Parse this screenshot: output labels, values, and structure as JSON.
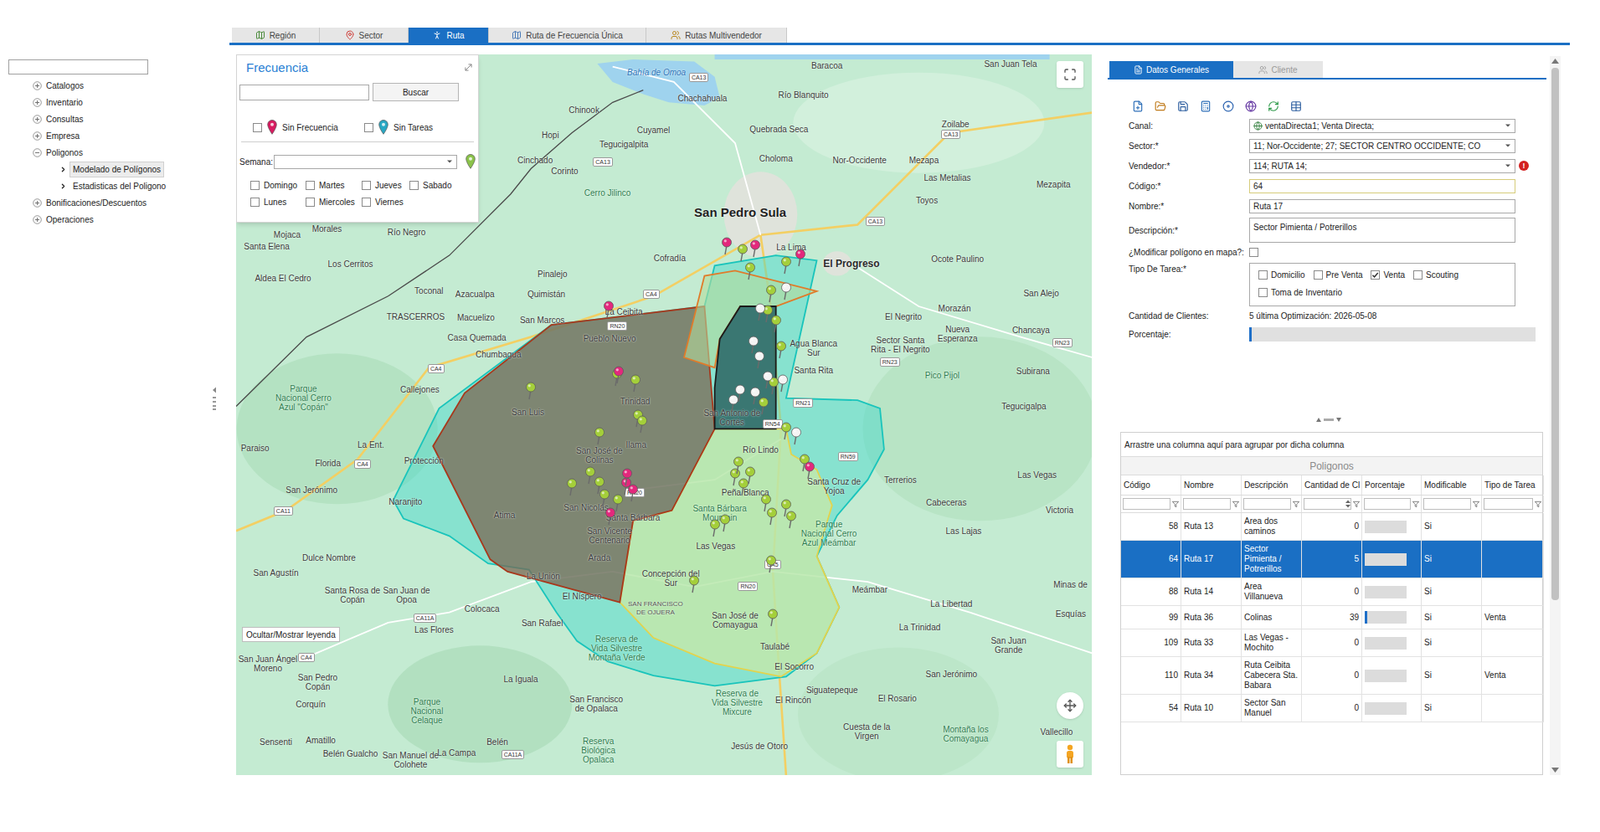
{
  "sidebar": {
    "search": {
      "value": ""
    },
    "tree": [
      {
        "label": "Catalogos",
        "expanded": false,
        "children": []
      },
      {
        "label": "Inventario",
        "expanded": false,
        "children": []
      },
      {
        "label": "Consultas",
        "expanded": false,
        "children": []
      },
      {
        "label": "Empresa",
        "expanded": false,
        "children": []
      },
      {
        "label": "Poligonos",
        "expanded": true,
        "children": [
          {
            "label": "Modelado de Polígonos",
            "selected": true
          },
          {
            "label": "Estadisticas del Poligono",
            "selected": false
          }
        ]
      },
      {
        "label": "Bonificaciones/Descuentos",
        "expanded": false,
        "children": []
      },
      {
        "label": "Operaciones",
        "expanded": false,
        "children": []
      }
    ]
  },
  "tabs": [
    {
      "label": "Región",
      "selected": false
    },
    {
      "label": "Sector",
      "selected": false
    },
    {
      "label": "Ruta",
      "selected": true
    },
    {
      "label": "Ruta de Frecuencia Única",
      "selected": false
    },
    {
      "label": "Rutas Multivendedor",
      "selected": false
    }
  ],
  "frequency_panel": {
    "title": "Frecuencia",
    "search": {
      "value": ""
    },
    "search_button": "Buscar",
    "legend": [
      {
        "label": "Sin Frecuencia",
        "checked": false,
        "color": "#d81b60"
      },
      {
        "label": "Sin Tareas",
        "checked": false,
        "color": "#29a8c4"
      }
    ],
    "week": {
      "label": "Semana:",
      "value": ""
    },
    "days": [
      {
        "label": "Domingo",
        "checked": false
      },
      {
        "label": "Martes",
        "checked": false
      },
      {
        "label": "Jueves",
        "checked": false
      },
      {
        "label": "Sabado",
        "checked": false
      },
      {
        "label": "Lunes",
        "checked": false
      },
      {
        "label": "Miercoles",
        "checked": false
      },
      {
        "label": "Viernes",
        "checked": false
      }
    ]
  },
  "map": {
    "legend_button": "Ocultar/Mostrar leyenda",
    "polygons": [
      {
        "color": "#3ed6cc"
      },
      {
        "color": "#cfe9a4"
      },
      {
        "color": "#7b6753"
      },
      {
        "color": "#b5dc9c"
      },
      {
        "color": "#2d6462"
      }
    ],
    "labels": [
      {
        "text": "Bahía de Omoa",
        "kind": "water"
      },
      {
        "text": "Chachahuala",
        "kind": "place"
      },
      {
        "text": "Río Blanquito",
        "kind": "place"
      },
      {
        "text": "Baracoa",
        "kind": "place"
      },
      {
        "text": "San Juan Tela",
        "kind": "place"
      },
      {
        "text": "Chinook",
        "kind": "place"
      },
      {
        "text": "Hopi",
        "kind": "place"
      },
      {
        "text": "Cuyamel",
        "kind": "place"
      },
      {
        "text": "Tegucigalpita",
        "kind": "place"
      },
      {
        "text": "Quebrada Seca",
        "kind": "place"
      },
      {
        "text": "Zoilabe",
        "kind": "place"
      },
      {
        "text": "Choloma",
        "kind": "place"
      },
      {
        "text": "Nor-Occidente",
        "kind": "place"
      },
      {
        "text": "Mezapa",
        "kind": "place"
      },
      {
        "text": "Cinchado",
        "kind": "place"
      },
      {
        "text": "Corinto",
        "kind": "place"
      },
      {
        "text": "Las Metalias",
        "kind": "place"
      },
      {
        "text": "Mezapita",
        "kind": "place"
      },
      {
        "text": "Cerro Jilinco",
        "kind": "park"
      },
      {
        "text": "Toyos",
        "kind": "place"
      },
      {
        "text": "San Pedro Sula",
        "kind": "city"
      },
      {
        "text": "Mojaca",
        "kind": "place"
      },
      {
        "text": "Morales",
        "kind": "place"
      },
      {
        "text": "Río Negro",
        "kind": "place"
      },
      {
        "text": "Santa Elena",
        "kind": "place"
      },
      {
        "text": "Cofradía",
        "kind": "place"
      },
      {
        "text": "La Lima",
        "kind": "place"
      },
      {
        "text": "El Progreso",
        "kind": "town"
      },
      {
        "text": "Ocote Paulino",
        "kind": "place"
      },
      {
        "text": "Los Cerritos",
        "kind": "place"
      },
      {
        "text": "Aldea El Cedro",
        "kind": "place"
      },
      {
        "text": "Pinalejo",
        "kind": "place"
      },
      {
        "text": "Toconal",
        "kind": "place"
      },
      {
        "text": "Azacualpa",
        "kind": "place"
      },
      {
        "text": "Quimistán",
        "kind": "place"
      },
      {
        "text": "San Alejo",
        "kind": "place"
      },
      {
        "text": "Morazán",
        "kind": "place"
      },
      {
        "text": "El Negrito",
        "kind": "place"
      },
      {
        "text": "TRASCERROS",
        "kind": "place"
      },
      {
        "text": "Macuelizo",
        "kind": "place"
      },
      {
        "text": "San Marcos",
        "kind": "place"
      },
      {
        "text": "La Ceibita",
        "kind": "place"
      },
      {
        "text": "Pueblo Nuevo",
        "kind": "place"
      },
      {
        "text": "Casa Quemada",
        "kind": "place"
      },
      {
        "text": "Chumbagua",
        "kind": "place"
      },
      {
        "text": "Nueva Esperanza",
        "kind": "place"
      },
      {
        "text": "Chancaya",
        "kind": "place"
      },
      {
        "text": "Agua Blanca Sur",
        "kind": "place"
      },
      {
        "text": "Santa Rita",
        "kind": "place"
      },
      {
        "text": "Sector Santa Rita - El Negrito",
        "kind": "place"
      },
      {
        "text": "Pico Pijol",
        "kind": "park"
      },
      {
        "text": "Subirana",
        "kind": "place"
      },
      {
        "text": "Callejones",
        "kind": "place"
      },
      {
        "text": "Parque Nacional Cerro Azul \"Copán\"",
        "kind": "park"
      },
      {
        "text": "San Luis",
        "kind": "place"
      },
      {
        "text": "Trinidad",
        "kind": "place"
      },
      {
        "text": "San Antonio de Cortés",
        "kind": "place"
      },
      {
        "text": "Tegucigalpa",
        "kind": "place"
      },
      {
        "text": "Ilama",
        "kind": "place"
      },
      {
        "text": "La Ent.",
        "kind": "place"
      },
      {
        "text": "Paraiso",
        "kind": "place"
      },
      {
        "text": "San José de Colinas",
        "kind": "place"
      },
      {
        "text": "Río Lindo",
        "kind": "place"
      },
      {
        "text": "Florida",
        "kind": "place"
      },
      {
        "text": "Protección",
        "kind": "place"
      },
      {
        "text": "Terrerios",
        "kind": "place"
      },
      {
        "text": "Las Vegas",
        "kind": "place"
      },
      {
        "text": "San Jerónimo",
        "kind": "place"
      },
      {
        "text": "Peña Blanca",
        "kind": "place"
      },
      {
        "text": "Santa Cruz de Yojoa",
        "kind": "place"
      },
      {
        "text": "Naranjito",
        "kind": "place"
      },
      {
        "text": "Cabeceras",
        "kind": "place"
      },
      {
        "text": "Victoria",
        "kind": "place"
      },
      {
        "text": "San Nicolás",
        "kind": "place"
      },
      {
        "text": "Atima",
        "kind": "place"
      },
      {
        "text": "Santa Bárbara",
        "kind": "place"
      },
      {
        "text": "Santa Bárbara Mountain",
        "kind": "park"
      },
      {
        "text": "San Vicente Centenario",
        "kind": "place"
      },
      {
        "text": "Las Vegas",
        "kind": "place"
      },
      {
        "text": "Parque Nacional Cerro Azul Meámbar",
        "kind": "park"
      },
      {
        "text": "Las Lajas",
        "kind": "place"
      },
      {
        "text": "Dulce Nombre",
        "kind": "place"
      },
      {
        "text": "Arada",
        "kind": "place"
      },
      {
        "text": "San Agustín",
        "kind": "place"
      },
      {
        "text": "La Unión",
        "kind": "place"
      },
      {
        "text": "Concepción del Sur",
        "kind": "place"
      },
      {
        "text": "Meámbar",
        "kind": "place"
      },
      {
        "text": "Minas de",
        "kind": "place"
      },
      {
        "text": "Santa Rosa de Copán",
        "kind": "place"
      },
      {
        "text": "San Juan de Opoa",
        "kind": "place"
      },
      {
        "text": "El Níspero",
        "kind": "place"
      },
      {
        "text": "Colocaca",
        "kind": "place"
      },
      {
        "text": "SAN FRANCISCO DE OJUERA",
        "kind": "area"
      },
      {
        "text": "La Libertad",
        "kind": "place"
      },
      {
        "text": "Esquías",
        "kind": "place"
      },
      {
        "text": "San Rafael",
        "kind": "place"
      },
      {
        "text": "San José de Comayagua",
        "kind": "place"
      },
      {
        "text": "La Trinidad",
        "kind": "place"
      },
      {
        "text": "Las Flores",
        "kind": "place"
      },
      {
        "text": "Reserva de Vida Silvestre Montaña Verde",
        "kind": "park"
      },
      {
        "text": "Taulabé",
        "kind": "place"
      },
      {
        "text": "San Juan Grande",
        "kind": "place"
      },
      {
        "text": "El Socorro",
        "kind": "place"
      },
      {
        "text": "La Iguala",
        "kind": "place"
      },
      {
        "text": "San Jerónimo",
        "kind": "place"
      },
      {
        "text": "San Juan Ángel Moreno",
        "kind": "place"
      },
      {
        "text": "San Pedro Copán",
        "kind": "place"
      },
      {
        "text": "Siguatepeque",
        "kind": "place"
      },
      {
        "text": "Corquín",
        "kind": "place"
      },
      {
        "text": "Parque Nacional Celaque",
        "kind": "park"
      },
      {
        "text": "San Francisco de Opalaca",
        "kind": "place"
      },
      {
        "text": "Reserva de Vida Silvestre Mixcure",
        "kind": "park"
      },
      {
        "text": "El Rincón",
        "kind": "place"
      },
      {
        "text": "El Rosario",
        "kind": "place"
      },
      {
        "text": "Sensenti",
        "kind": "place"
      },
      {
        "text": "Amatillo",
        "kind": "place"
      },
      {
        "text": "Belén",
        "kind": "place"
      },
      {
        "text": "Reserva Biológica Opalaca",
        "kind": "park"
      },
      {
        "text": "Belén Gualcho",
        "kind": "place"
      },
      {
        "text": "La Campa",
        "kind": "place"
      },
      {
        "text": "Jesús de Otoro",
        "kind": "place"
      },
      {
        "text": "Cuesta de la Virgen",
        "kind": "place"
      },
      {
        "text": "Montaña los Comayagua",
        "kind": "park"
      },
      {
        "text": "Vallecillo",
        "kind": "place"
      },
      {
        "text": "San Manuel de Colohete",
        "kind": "place"
      }
    ],
    "road_shields": [
      "CA13",
      "CA13",
      "CA13",
      "CA13",
      "CA4",
      "CA4",
      "CA4",
      "CA11",
      "RN20",
      "RN20",
      "RN54",
      "RN21",
      "RN59",
      "CA5",
      "RN20",
      "RN23",
      "RN23",
      "CA11A",
      "CA4",
      "CA11A"
    ],
    "pins": [
      {
        "color": "#a4cf3a"
      },
      {
        "color": "#a4cf3a"
      },
      {
        "color": "#a4cf3a"
      },
      {
        "color": "#a4cf3a"
      },
      {
        "color": "#a4cf3a"
      },
      {
        "color": "#a4cf3a"
      },
      {
        "color": "#a4cf3a"
      },
      {
        "color": "#a4cf3a"
      },
      {
        "color": "#a4cf3a"
      },
      {
        "color": "#a4cf3a"
      },
      {
        "color": "#a4cf3a"
      },
      {
        "color": "#a4cf3a"
      },
      {
        "color": "#a4cf3a"
      },
      {
        "color": "#a4cf3a"
      },
      {
        "color": "#a4cf3a"
      },
      {
        "color": "#a4cf3a"
      },
      {
        "color": "#a4cf3a"
      },
      {
        "color": "#a4cf3a"
      },
      {
        "color": "#a4cf3a"
      },
      {
        "color": "#a4cf3a"
      },
      {
        "color": "#a4cf3a"
      },
      {
        "color": "#a4cf3a"
      },
      {
        "color": "#a4cf3a"
      },
      {
        "color": "#a4cf3a"
      },
      {
        "color": "#a4cf3a"
      },
      {
        "color": "#a4cf3a"
      },
      {
        "color": "#a4cf3a"
      },
      {
        "color": "#a4cf3a"
      },
      {
        "color": "#a4cf3a"
      },
      {
        "color": "#a4cf3a"
      },
      {
        "color": "#a4cf3a"
      },
      {
        "color": "#a4cf3a"
      },
      {
        "color": "#a4cf3a"
      },
      {
        "color": "#a4cf3a"
      },
      {
        "color": "#a4cf3a"
      },
      {
        "color": "#e3287c"
      },
      {
        "color": "#e3287c"
      },
      {
        "color": "#e3287c"
      },
      {
        "color": "#e3287c"
      },
      {
        "color": "#e3287c"
      },
      {
        "color": "#e3287c"
      },
      {
        "color": "#e3287c"
      },
      {
        "color": "#e3287c"
      },
      {
        "color": "#e3287c"
      },
      {
        "color": "#e3287c"
      },
      {
        "color": "#f4f4f4"
      },
      {
        "color": "#f4f4f4"
      },
      {
        "color": "#f4f4f4"
      },
      {
        "color": "#f4f4f4"
      },
      {
        "color": "#f4f4f4"
      },
      {
        "color": "#f4f4f4"
      },
      {
        "color": "#f4f4f4"
      },
      {
        "color": "#f4f4f4"
      },
      {
        "color": "#f4f4f4"
      },
      {
        "color": "#f4f4f4"
      }
    ]
  },
  "details": {
    "tabs": [
      {
        "label": "Datos Generales",
        "selected": true,
        "disabled": false
      },
      {
        "label": "Cliente",
        "selected": false,
        "disabled": true
      }
    ],
    "fields": [
      {
        "kind": "icon-select",
        "label": "Canal:",
        "value": "ventaDirecta1; Venta Directa;"
      },
      {
        "kind": "select",
        "label": "Sector:*",
        "value": "11; Nor-Occidente; 27; SECTOR CENTRO OCCIDENTE; CO"
      },
      {
        "kind": "select",
        "label": "Vendedor:*",
        "value": "114; RUTA 14;",
        "error": "!"
      },
      {
        "kind": "input",
        "label": "Código:*",
        "value": "64",
        "highlighted": true
      },
      {
        "kind": "input",
        "label": "Nombre:*",
        "value": "Ruta 17",
        "highlighted": false
      },
      {
        "kind": "textarea",
        "label": "Descripción:*",
        "value": "Sector Pimienta / Potrerillos"
      },
      {
        "kind": "checkbox",
        "label": "¿Modificar polígono en mapa?:",
        "checked": false
      },
      {
        "kind": "checkgroup",
        "label": "Tipo De Tarea:*",
        "options": [
          {
            "label": "Domicilio",
            "checked": false
          },
          {
            "label": "Pre Venta",
            "checked": false
          },
          {
            "label": "Venta",
            "checked": true
          },
          {
            "label": "Scouting",
            "checked": false
          },
          {
            "label": "Toma de Inventario",
            "checked": false
          }
        ]
      },
      {
        "kind": "text",
        "label": "Cantidad de Clientes:",
        "value": "5 última Optimización: 2026-05-08"
      },
      {
        "kind": "progress",
        "label": "Porcentaje:",
        "level": 0.01
      }
    ]
  },
  "grid": {
    "group_hint": "Arrastre una columna aquí para agrupar por dicha columna",
    "title": "Poligonos",
    "columns": [
      "Código",
      "Nombre",
      "Descripción",
      "Cantidad de Cl",
      "Porcentaje",
      "Modificable",
      "Tipo de Tarea"
    ],
    "rows": [
      {
        "code": "58",
        "name": "Ruta 13",
        "description": "Area dos caminos",
        "count": "0",
        "level": 0,
        "modifiable": "Si",
        "task": "",
        "selected": false
      },
      {
        "code": "64",
        "name": "Ruta 17",
        "description": "Sector Pimienta / Potrerillos",
        "count": "5",
        "level": 0,
        "modifiable": "Si",
        "task": "",
        "selected": true
      },
      {
        "code": "88",
        "name": "Ruta 14",
        "description": "Area Villanueva",
        "count": "0",
        "level": 0,
        "modifiable": "Si",
        "task": "",
        "selected": false
      },
      {
        "code": "99",
        "name": "Ruta 36",
        "description": "Colinas",
        "count": "39",
        "level": 0.05,
        "modifiable": "Si",
        "task": "Venta",
        "selected": false
      },
      {
        "code": "109",
        "name": "Ruta 33",
        "description": "Las Vegas - Mochito",
        "count": "0",
        "level": 0,
        "modifiable": "Si",
        "task": "",
        "selected": false
      },
      {
        "code": "110",
        "name": "Ruta 34",
        "description": "Ruta Ceibita Cabecera Sta. Babara",
        "count": "0",
        "level": 0,
        "modifiable": "Si",
        "task": "Venta",
        "selected": false
      },
      {
        "code": "54",
        "name": "Ruta 10",
        "description": "Sector San Manuel",
        "count": "0",
        "level": 0,
        "modifiable": "Si",
        "task": "",
        "selected": false
      }
    ]
  }
}
